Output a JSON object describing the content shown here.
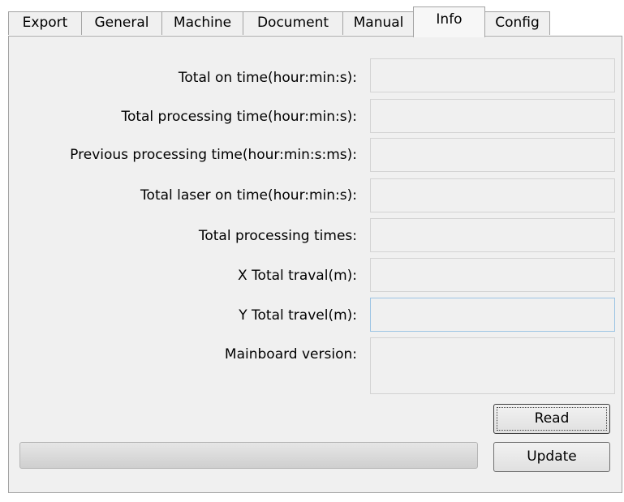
{
  "tabs": [
    {
      "label": "Export",
      "active": false
    },
    {
      "label": "General",
      "active": false
    },
    {
      "label": "Machine",
      "active": false
    },
    {
      "label": "Document",
      "active": false
    },
    {
      "label": "Manual",
      "active": false
    },
    {
      "label": "Info",
      "active": true
    },
    {
      "label": "Config",
      "active": false
    }
  ],
  "info": {
    "rows": [
      {
        "label": "Total on time(hour:min:s):",
        "value": ""
      },
      {
        "label": "Total processing time(hour:min:s):",
        "value": ""
      },
      {
        "label": "Previous processing time(hour:min:s:ms):",
        "value": ""
      },
      {
        "label": "Total laser on time(hour:min:s):",
        "value": ""
      },
      {
        "label": "Total processing times:",
        "value": ""
      },
      {
        "label": "X Total traval(m):",
        "value": ""
      },
      {
        "label": "Y Total travel(m):",
        "value": ""
      },
      {
        "label": "Mainboard version:",
        "value": ""
      }
    ]
  },
  "buttons": {
    "read_label": "Read",
    "update_label": "Update"
  },
  "progress": {
    "fraction": 0
  }
}
